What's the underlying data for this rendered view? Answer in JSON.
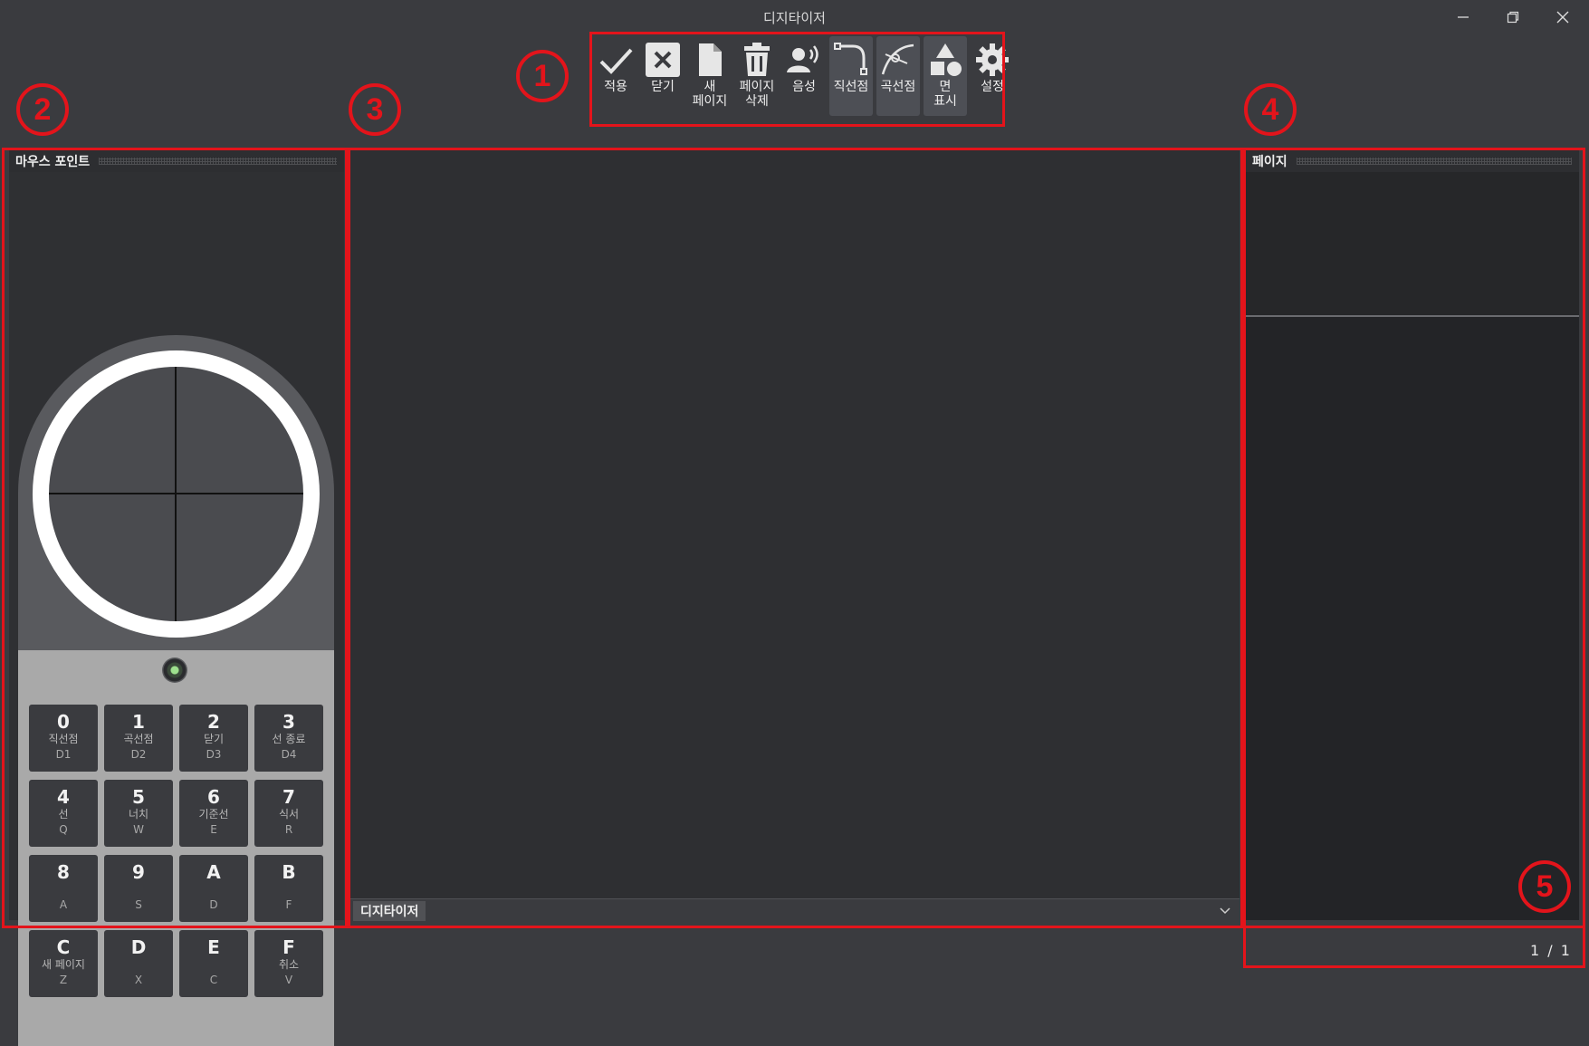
{
  "window": {
    "title": "디지타이저"
  },
  "toolbar": {
    "items": [
      {
        "label": "적용",
        "icon": "check-icon"
      },
      {
        "label": "닫기",
        "icon": "close-box-icon"
      },
      {
        "label": "새\n페이지",
        "icon": "new-page-icon"
      },
      {
        "label": "페이지\n삭제",
        "icon": "trash-icon"
      },
      {
        "label": "음성",
        "icon": "voice-icon"
      },
      {
        "label": "직선점",
        "icon": "line-point-icon",
        "active": true
      },
      {
        "label": "곡선점",
        "icon": "curve-point-icon",
        "active": true
      },
      {
        "label": "면\n표시",
        "icon": "shapes-icon",
        "active": true
      },
      {
        "label": "설정",
        "icon": "gear-icon"
      }
    ]
  },
  "mouse_panel": {
    "title": "마우스 포인트",
    "keys": [
      {
        "main": "0",
        "sub": "직선점",
        "short": "D1"
      },
      {
        "main": "1",
        "sub": "곡선점",
        "short": "D2"
      },
      {
        "main": "2",
        "sub": "닫기",
        "short": "D3"
      },
      {
        "main": "3",
        "sub": "선 종료",
        "short": "D4"
      },
      {
        "main": "4",
        "sub": "선",
        "short": "Q"
      },
      {
        "main": "5",
        "sub": "너치",
        "short": "W"
      },
      {
        "main": "6",
        "sub": "기준선",
        "short": "E"
      },
      {
        "main": "7",
        "sub": "식서",
        "short": "R"
      },
      {
        "main": "8",
        "sub": "",
        "short": "A"
      },
      {
        "main": "9",
        "sub": "",
        "short": "S"
      },
      {
        "main": "A",
        "sub": "",
        "short": "D"
      },
      {
        "main": "B",
        "sub": "",
        "short": "F"
      },
      {
        "main": "C",
        "sub": "새 페이지",
        "short": "Z"
      },
      {
        "main": "D",
        "sub": "",
        "short": "X"
      },
      {
        "main": "E",
        "sub": "",
        "short": "C"
      },
      {
        "main": "F",
        "sub": "취소",
        "short": "V"
      }
    ]
  },
  "canvas": {
    "tab_label": "디지타이저"
  },
  "page_panel": {
    "title": "페이지"
  },
  "status": {
    "page_counter": "1 / 1"
  },
  "annotations": {
    "b1": "1",
    "b2": "2",
    "b3": "3",
    "b4": "4",
    "b5": "5"
  },
  "colors": {
    "annotation_red": "#e3141b",
    "background": "#3a3b3f"
  }
}
